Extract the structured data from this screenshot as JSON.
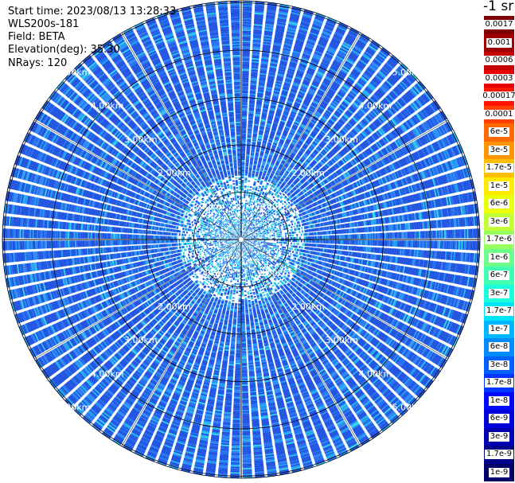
{
  "header": {
    "start_time": "Start time: 2023/08/13 13:28:33",
    "instrument": "WLS200s-181",
    "field": "Field: BETA",
    "elevation": "Elevation(deg): 35.30",
    "nrays": "NRays: 120"
  },
  "range_rings": [
    {
      "label": "1.00km",
      "km": 1
    },
    {
      "label": "2.00km",
      "km": 2
    },
    {
      "label": "3.00km",
      "km": 3
    },
    {
      "label": "4.00km",
      "km": 4
    },
    {
      "label": "5.00km",
      "km": 5
    }
  ],
  "colorbar": {
    "unit_label": "-1 sr",
    "levels": [
      {
        "label": "0.0017",
        "color": "#7f0000"
      },
      {
        "label": "0.001",
        "color": "#a00000"
      },
      {
        "label": "0.0006",
        "color": "#c40000"
      },
      {
        "label": "0.0003",
        "color": "#e80000"
      },
      {
        "label": "0.00017",
        "color": "#ff1500"
      },
      {
        "label": "0.0001",
        "color": "#ff4000"
      },
      {
        "label": "6e-5",
        "color": "#ff6a00"
      },
      {
        "label": "3e-5",
        "color": "#ff9500"
      },
      {
        "label": "1.7e-5",
        "color": "#ffbf00"
      },
      {
        "label": "1e-5",
        "color": "#ffea00"
      },
      {
        "label": "6e-6",
        "color": "#eaff0c"
      },
      {
        "label": "3e-6",
        "color": "#c1ff36"
      },
      {
        "label": "1.7e-6",
        "color": "#97ff60"
      },
      {
        "label": "1e-6",
        "color": "#6dff8a"
      },
      {
        "label": "6e-7",
        "color": "#43ffb4"
      },
      {
        "label": "3e-7",
        "color": "#19ffde"
      },
      {
        "label": "1.7e-7",
        "color": "#00e4f8"
      },
      {
        "label": "1e-7",
        "color": "#00b8ff"
      },
      {
        "label": "6e-8",
        "color": "#008cff"
      },
      {
        "label": "3e-8",
        "color": "#0060ff"
      },
      {
        "label": "1.7e-8",
        "color": "#0034ff"
      },
      {
        "label": "1e-8",
        "color": "#0008ff"
      },
      {
        "label": "6e-9",
        "color": "#0000d8"
      },
      {
        "label": "3e-9",
        "color": "#0000b0"
      },
      {
        "label": "1.7e-9",
        "color": "#000088"
      },
      {
        "label": "1e-9",
        "color": "#00006a"
      }
    ]
  }
}
